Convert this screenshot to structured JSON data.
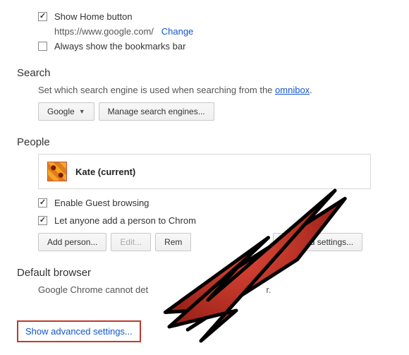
{
  "top": {
    "show_home_label": "Show Home button",
    "home_url": "https://www.google.com/",
    "change_label": "Change",
    "bookmarks_label": "Always show the bookmarks bar"
  },
  "search": {
    "title": "Search",
    "desc_prefix": "Set which search engine is used when searching from the ",
    "omnibox": "omnibox",
    "engine": "Google",
    "manage_label": "Manage search engines..."
  },
  "people": {
    "title": "People",
    "current_name": "Kate (current)",
    "guest_label": "Enable Guest browsing",
    "anyone_label": "Let anyone add a person to Chrom",
    "add_label": "Add person...",
    "edit_label": "Edit...",
    "remove_label": "Rem",
    "import_label": "arks and settings..."
  },
  "default_browser": {
    "title": "Default browser",
    "text_prefix": "Google Chrome cannot det",
    "text_suffix": "r."
  },
  "advanced": {
    "label": "Show advanced settings..."
  }
}
